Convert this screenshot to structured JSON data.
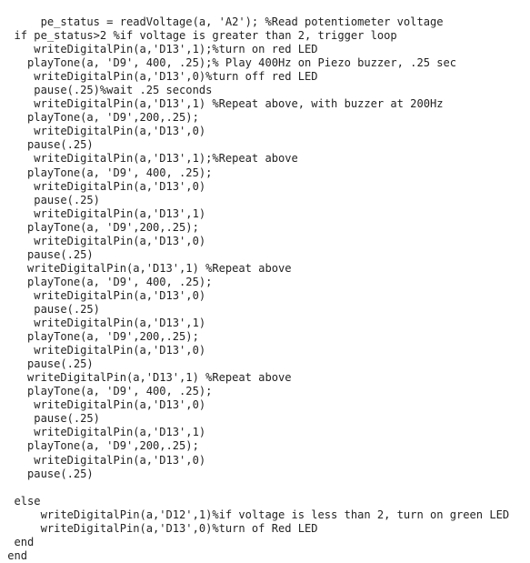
{
  "document": {
    "kind": "code-listing",
    "language": "MATLAB",
    "background_color": "#ffffff",
    "text_color": "#232323"
  },
  "code": {
    "lines": [
      "      pe_status = readVoltage(a, 'A2'); %Read potentiometer voltage",
      "  if pe_status>2 %if voltage is greater than 2, trigger loop",
      "     writeDigitalPin(a,'D13',1);%turn on red LED",
      "    playTone(a, 'D9', 400, .25);% Play 400Hz on Piezo buzzer, .25 sec",
      "     writeDigitalPin(a,'D13',0)%turn off red LED",
      "     pause(.25)%wait .25 seconds",
      "     writeDigitalPin(a,'D13',1) %Repeat above, with buzzer at 200Hz",
      "    playTone(a, 'D9',200,.25);",
      "     writeDigitalPin(a,'D13',0)",
      "    pause(.25)",
      "     writeDigitalPin(a,'D13',1);%Repeat above",
      "    playTone(a, 'D9', 400, .25);",
      "     writeDigitalPin(a,'D13',0)",
      "     pause(.25)",
      "     writeDigitalPin(a,'D13',1)",
      "    playTone(a, 'D9',200,.25);",
      "     writeDigitalPin(a,'D13',0)",
      "    pause(.25)",
      "    writeDigitalPin(a,'D13',1) %Repeat above",
      "    playTone(a, 'D9', 400, .25);",
      "     writeDigitalPin(a,'D13',0)",
      "     pause(.25)",
      "     writeDigitalPin(a,'D13',1)",
      "    playTone(a, 'D9',200,.25);",
      "     writeDigitalPin(a,'D13',0)",
      "    pause(.25)",
      "    writeDigitalPin(a,'D13',1) %Repeat above",
      "    playTone(a, 'D9', 400, .25);",
      "     writeDigitalPin(a,'D13',0)",
      "     pause(.25)",
      "     writeDigitalPin(a,'D13',1)",
      "    playTone(a, 'D9',200,.25);",
      "     writeDigitalPin(a,'D13',0)",
      "    pause(.25)",
      "",
      "  else",
      "      writeDigitalPin(a,'D12',1)%if voltage is less than 2, turn on green LED",
      "      writeDigitalPin(a,'D13',0)%turn of Red LED",
      "  end",
      " end"
    ]
  }
}
